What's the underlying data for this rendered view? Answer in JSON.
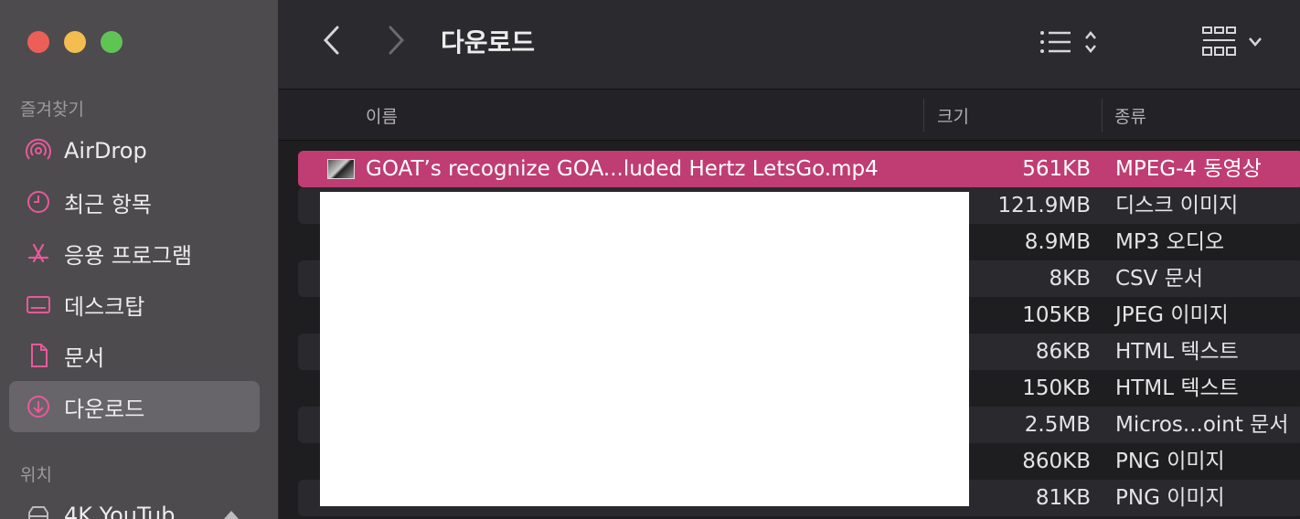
{
  "window": {
    "title": "다운로드"
  },
  "sidebar": {
    "favorites_label": "즐겨찾기",
    "items": [
      {
        "label": "AirDrop",
        "icon": "airdrop-icon"
      },
      {
        "label": "최근 항목",
        "icon": "clock-icon"
      },
      {
        "label": "응용 프로그램",
        "icon": "applications-icon"
      },
      {
        "label": "데스크탑",
        "icon": "desktop-icon"
      },
      {
        "label": "문서",
        "icon": "document-icon"
      },
      {
        "label": "다운로드",
        "icon": "download-icon",
        "active": true
      }
    ],
    "locations_label": "위치",
    "locations": [
      {
        "label": "4K YouTub",
        "icon": "drive-icon"
      }
    ]
  },
  "columns": {
    "name": "이름",
    "size": "크기",
    "kind": "종류"
  },
  "files": [
    {
      "name": "GOAT’s recognize GOA...luded Hertz LetsGo.mp4",
      "size": "561KB",
      "kind": "MPEG-4 동영상",
      "selected": true
    },
    {
      "name": "",
      "size": "121.9MB",
      "kind": "디스크 이미지"
    },
    {
      "name": "",
      "size": "8.9MB",
      "kind": "MP3 오디오"
    },
    {
      "name": "",
      "size": "8KB",
      "kind": "CSV 문서"
    },
    {
      "name": "",
      "size": "105KB",
      "kind": "JPEG 이미지"
    },
    {
      "name": "",
      "size": "86KB",
      "kind": "HTML 텍스트"
    },
    {
      "name": "",
      "size": "150KB",
      "kind": "HTML 텍스트"
    },
    {
      "name": "",
      "size": "2.5MB",
      "kind": "Micros...oint 문서"
    },
    {
      "name": "",
      "size": "860KB",
      "kind": "PNG 이미지"
    },
    {
      "name": "",
      "size": "81KB",
      "kind": "PNG 이미지"
    }
  ],
  "colors": {
    "accent": "#bf3d73",
    "sidebar_icon": "#e8599a"
  }
}
